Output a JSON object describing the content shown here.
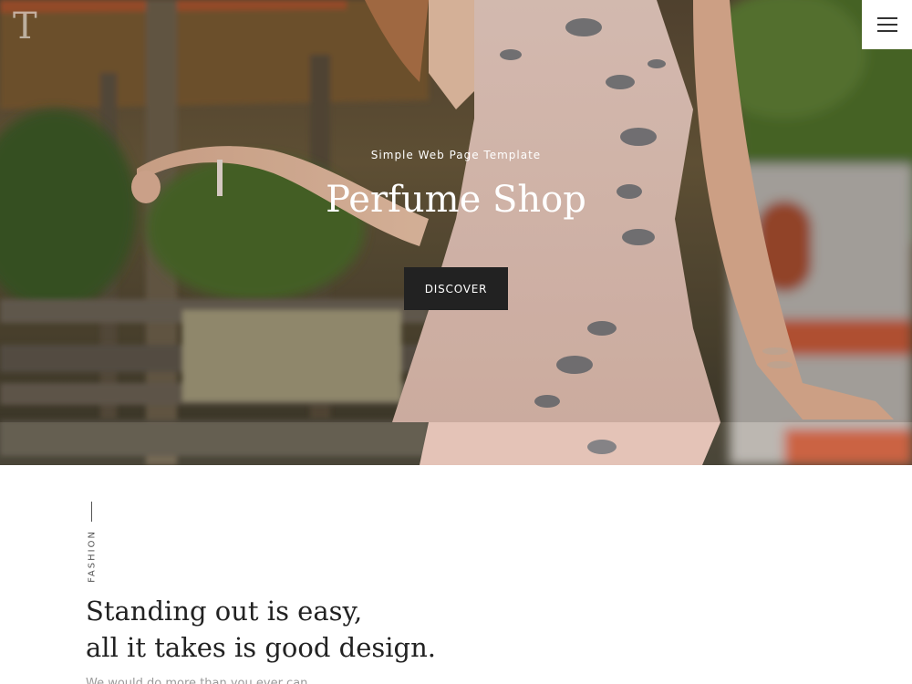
{
  "header": {
    "logo_letter": "T",
    "menu_icon": "hamburger-menu-icon"
  },
  "hero": {
    "subtitle": "Simple Web Page Template",
    "title": "Perfume Shop",
    "cta_label": "DISCOVER",
    "image": "woman-in-floral-dress-photo"
  },
  "section": {
    "label": "FASHION",
    "headline_lines": [
      "Standing out is easy,",
      "all it takes is good design."
    ],
    "body_text": "We would do more than you ever can..."
  },
  "colors": {
    "button_bg": "#222222",
    "text_dark": "#222222",
    "text_muted": "#555555"
  }
}
